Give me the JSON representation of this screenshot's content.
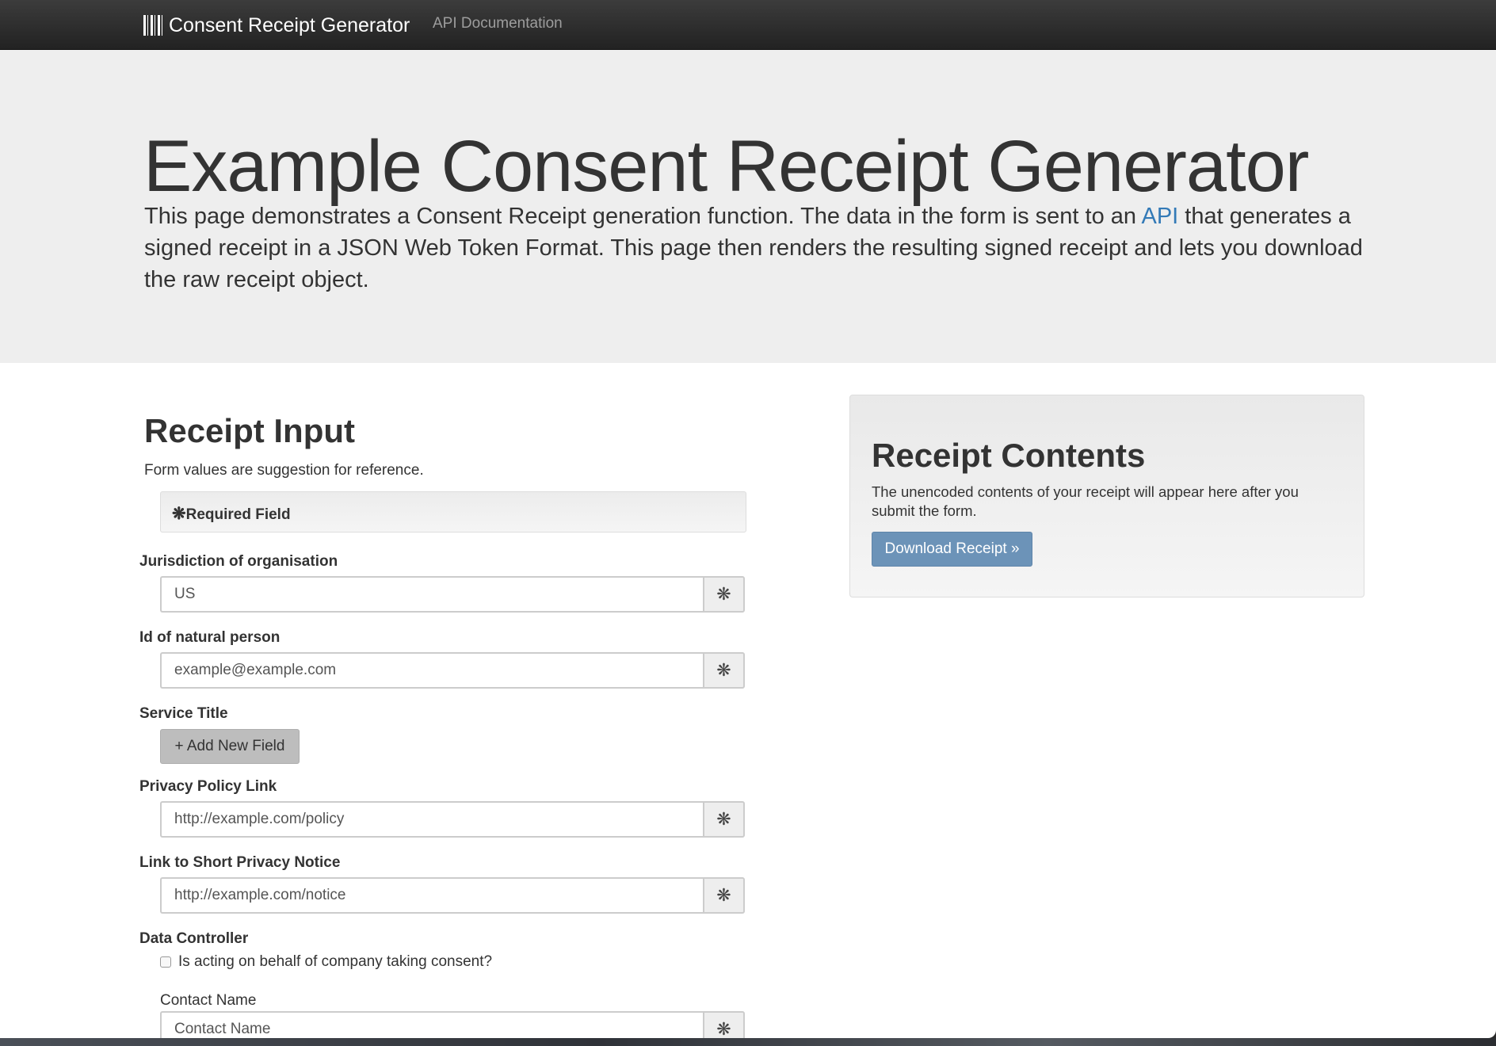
{
  "navbar": {
    "brand": "Consent Receipt Generator",
    "brand_icon": "barcode-icon",
    "links": [
      "API Documentation"
    ]
  },
  "hero": {
    "title": "Example Consent Receipt Generator",
    "text_before_link": "This page demonstrates a Consent Receipt generation function. The data in the form is sent to an ",
    "link_text": "API",
    "text_after_link": " that generates a signed receipt in a JSON Web Token Format. This page then renders the resulting signed receipt and lets you download the raw receipt object."
  },
  "receipt_input": {
    "title": "Receipt Input",
    "subtitle": "Form values are suggestion for reference.",
    "required_note": "Required Field",
    "required_symbol": "❋",
    "fields": [
      {
        "label": "Jurisdiction of organisation",
        "value": "",
        "placeholder": "US"
      },
      {
        "label": "Id of natural person",
        "value": "",
        "placeholder": "example@example.com"
      },
      {
        "label": "Privacy Policy Link",
        "value": "",
        "placeholder": "http://example.com/policy"
      },
      {
        "label": "Link to Short Privacy Notice",
        "value": "",
        "placeholder": "http://example.com/notice"
      }
    ],
    "service_title_label": "Service Title",
    "add_field_button": "+ Add New Field",
    "data_controller": {
      "label": "Data Controller",
      "checkbox_label": "Is acting on behalf of company taking consent?",
      "checked": false,
      "contact_name_label": "Contact Name",
      "contact_name_placeholder": "Contact Name"
    }
  },
  "receipt_contents": {
    "title": "Receipt Contents",
    "description": "The unencoded contents of your receipt will appear here after you submit the form.",
    "download_button": "Download Receipt »"
  },
  "colors": {
    "navbar": "#222222",
    "hero_bg": "#eeeeee",
    "link": "#337ab7",
    "primary_button": "#6c93b8"
  }
}
